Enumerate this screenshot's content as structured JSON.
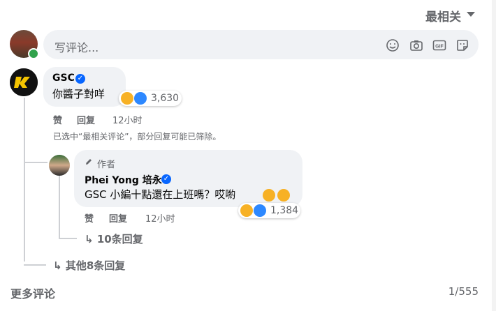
{
  "sort": {
    "label": "最相关"
  },
  "composer": {
    "placeholder": "写评论..."
  },
  "comments": [
    {
      "author": "GSC",
      "text": "你醬子對咩",
      "reaction_count": "3,630",
      "actions": {
        "like": "赞",
        "reply": "回复"
      },
      "time": "12小时",
      "notice": "已选中“最相关评论”，部分回复可能已筛除。",
      "replies": [
        {
          "badge": "作者",
          "author": "Phei Yong 培永",
          "text": "GSC 小編十點還在上班嗎？哎喲",
          "reaction_count": "1,384",
          "actions": {
            "like": "赞",
            "reply": "回复"
          },
          "time": "12小时",
          "more_replies": "10条回复"
        }
      ],
      "other_replies": "其他8条回复"
    }
  ],
  "footer": {
    "more_comments": "更多评论",
    "pager": "1/555"
  },
  "icons": [
    "smiley-icon",
    "camera-icon",
    "gif-icon",
    "sticker-icon",
    "verified-icon",
    "haha-reaction-icon",
    "like-reaction-icon",
    "pencil-icon",
    "reply-arrow-icon",
    "caret-down-icon"
  ],
  "colors": {
    "verified": "#0866ff",
    "online": "#31a24c",
    "bubble": "#f0f2f5",
    "muted": "#65676b"
  }
}
